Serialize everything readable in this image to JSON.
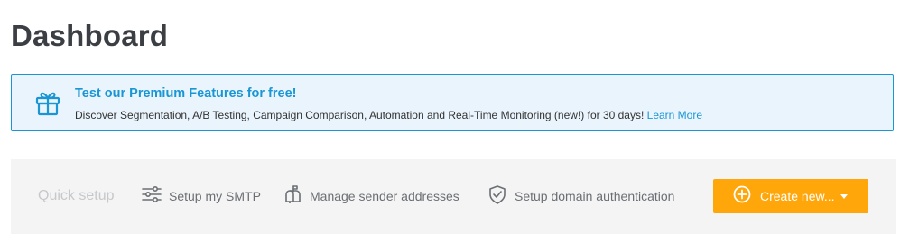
{
  "page": {
    "title": "Dashboard"
  },
  "promo": {
    "icon": "gift-icon",
    "title": "Test our Premium Features for free!",
    "description": "Discover Segmentation, A/B Testing, Campaign Comparison, Automation and Real-Time Monitoring (new!) for 30 days!",
    "link_label": "Learn More",
    "accent_color": "#1a96d4",
    "background_color": "#eaf4fc"
  },
  "quick_setup": {
    "label": "Quick setup",
    "items": [
      {
        "icon": "sliders-icon",
        "label": "Setup my SMTP"
      },
      {
        "icon": "mailbox-icon",
        "label": "Manage sender addresses"
      },
      {
        "icon": "shield-check-icon",
        "label": "Setup domain authentication"
      }
    ],
    "create_button": {
      "icon": "plus-circle-icon",
      "label": "Create new...",
      "color": "#ffa60a"
    }
  }
}
